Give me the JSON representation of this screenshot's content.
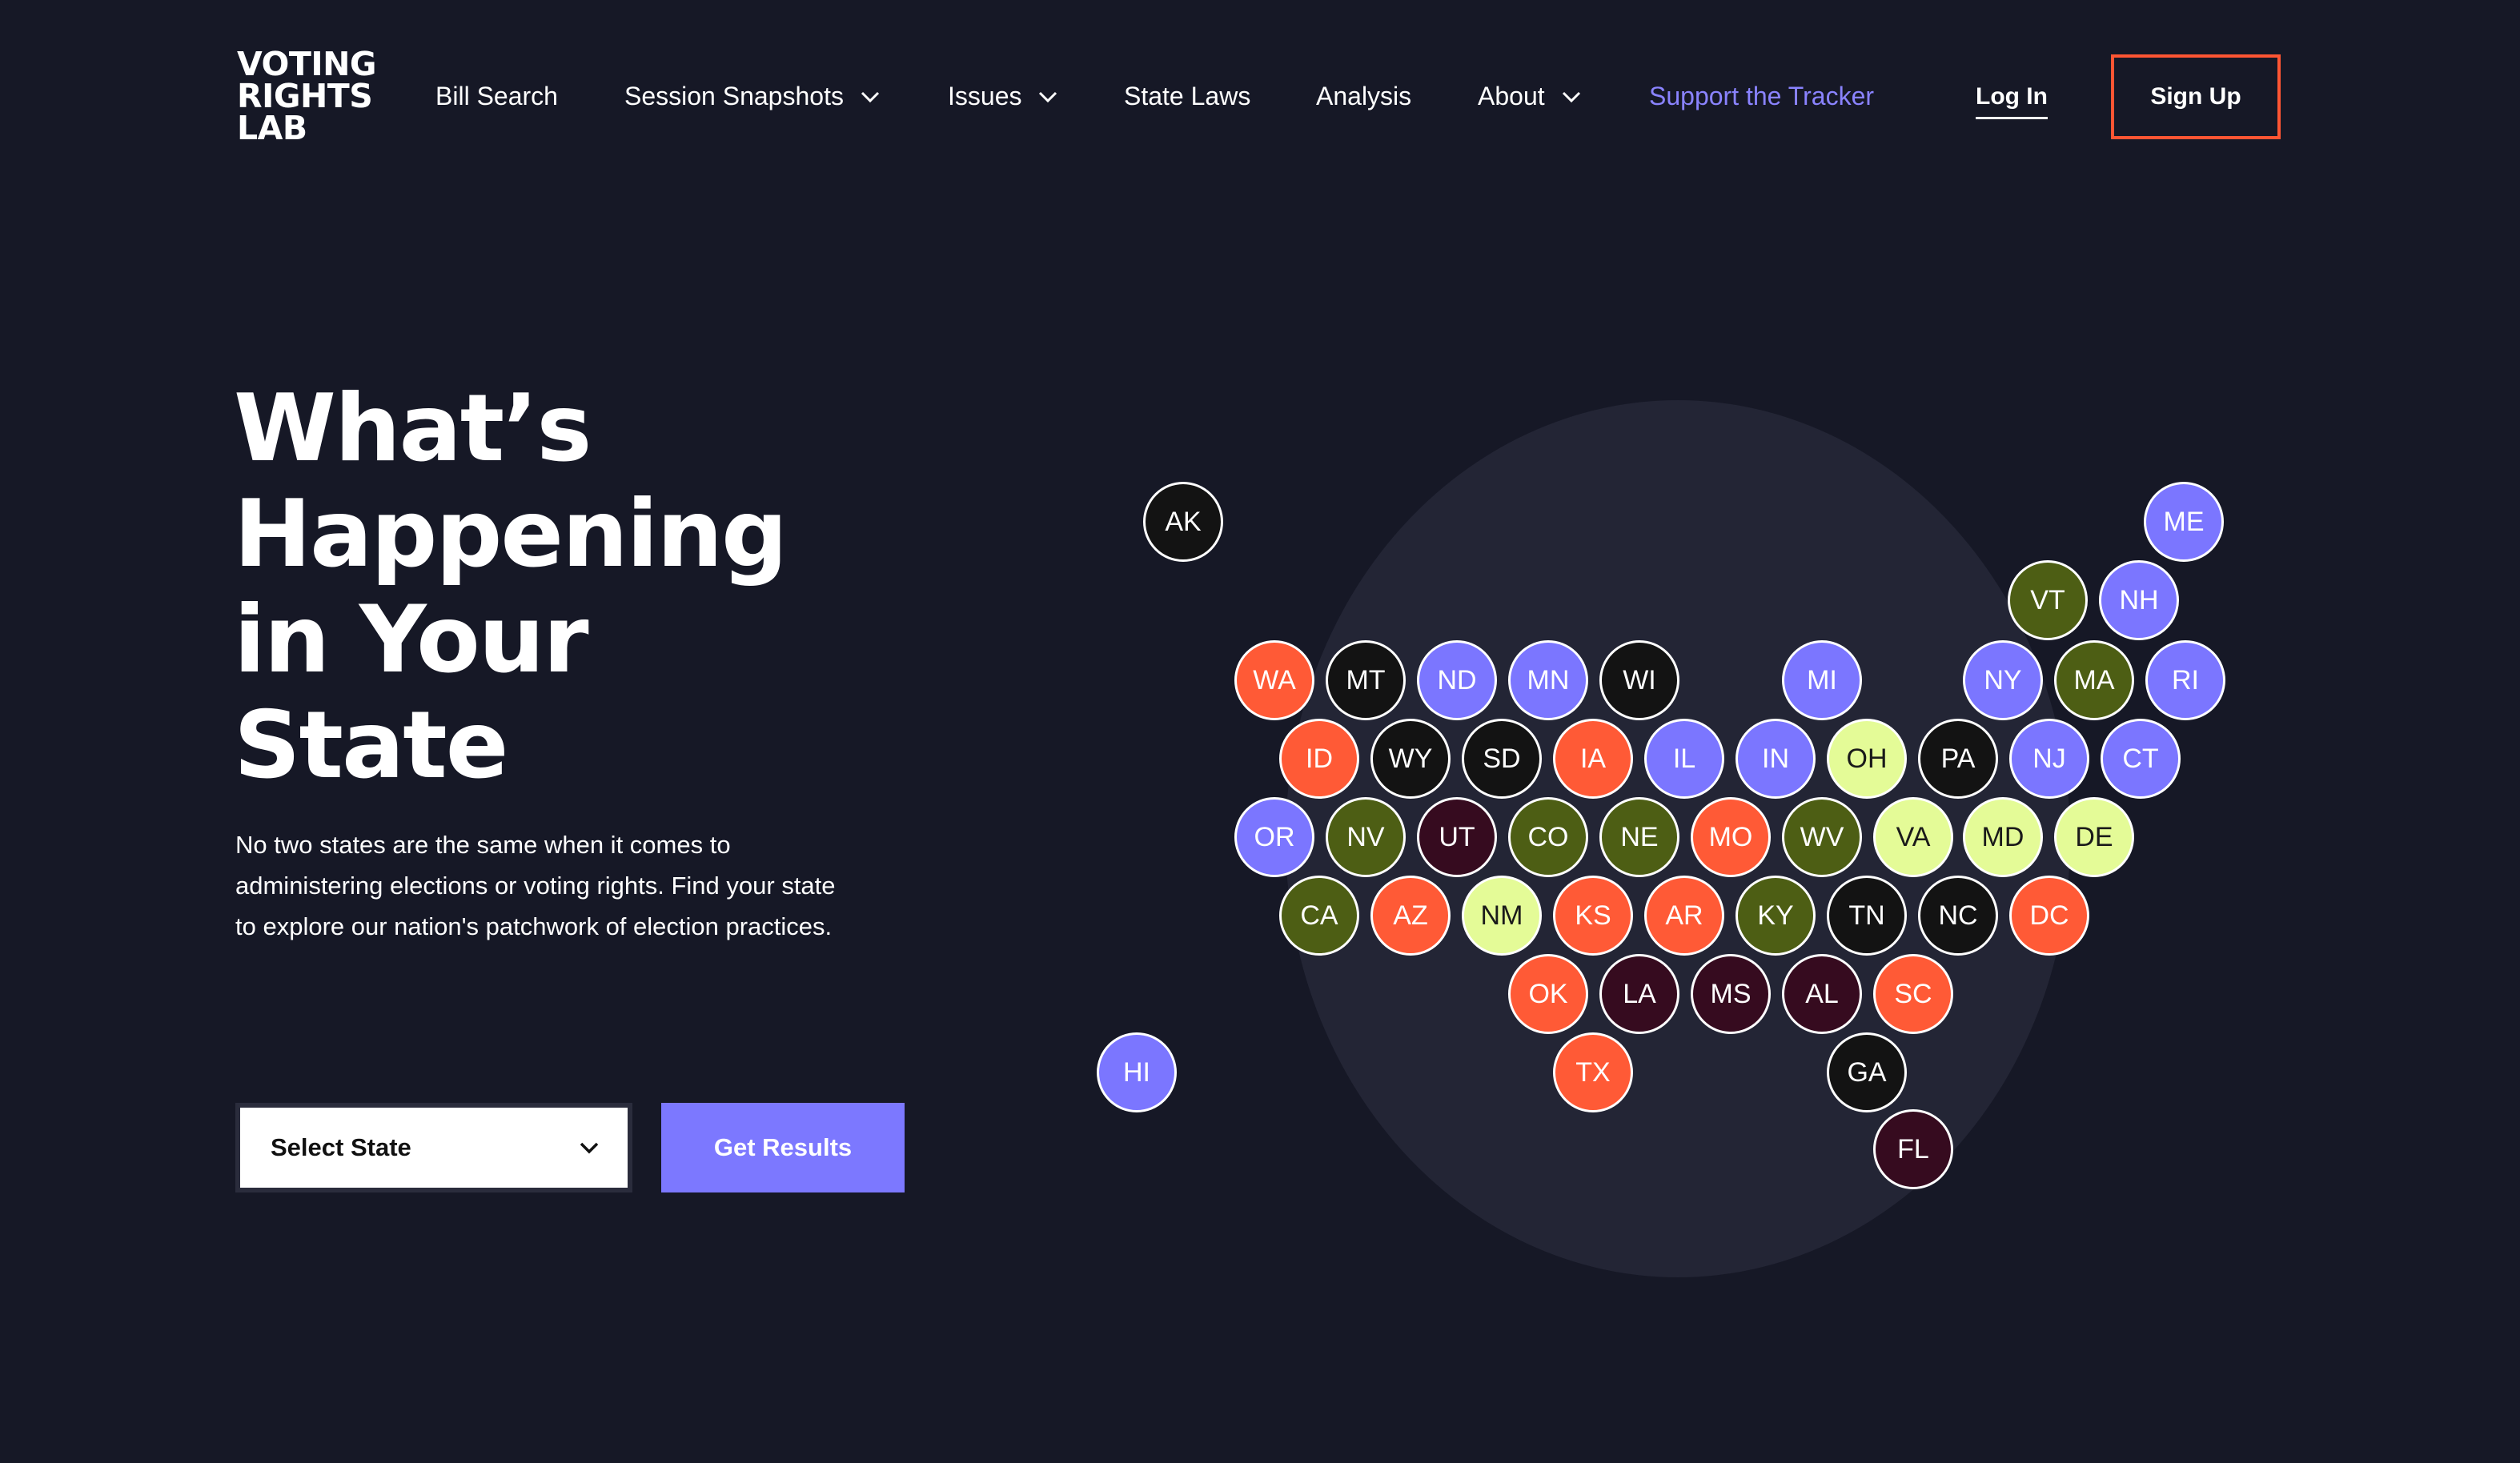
{
  "logo": {
    "lines": [
      "VOTING",
      "RIGHTS",
      "LAB"
    ]
  },
  "nav": {
    "bill_search": "Bill Search",
    "session_snapshots": "Session Snapshots",
    "issues": "Issues",
    "state_laws": "State Laws",
    "analysis": "Analysis",
    "about": "About",
    "support": "Support the Tracker",
    "log_in": "Log In",
    "sign_up": "Sign Up"
  },
  "hero": {
    "title_lines": [
      "What’s",
      "Happening",
      "in Your",
      "State"
    ],
    "description": "No two states are the same when it comes to administering elections or voting rights. Find your state to explore our nation's patchwork of election practices."
  },
  "controls": {
    "select_label": "Select State",
    "submit_label": "Get Results"
  },
  "colors": {
    "background": "#161826",
    "accent": "#7c78ff",
    "signup_border": "#ff5533",
    "black": "#131313",
    "purple": "#7b76ff",
    "orange": "#ff5a36",
    "olive": "#4d5e14",
    "lime": "#e4fb97",
    "maroon": "#360b1f"
  },
  "states": [
    {
      "abbr": "AK",
      "color": "black"
    },
    {
      "abbr": "ME",
      "color": "purple"
    },
    {
      "abbr": "VT",
      "color": "olive"
    },
    {
      "abbr": "NH",
      "color": "purple"
    },
    {
      "abbr": "WA",
      "color": "orange"
    },
    {
      "abbr": "MT",
      "color": "black"
    },
    {
      "abbr": "ND",
      "color": "purple"
    },
    {
      "abbr": "MN",
      "color": "purple"
    },
    {
      "abbr": "WI",
      "color": "black"
    },
    {
      "abbr": "MI",
      "color": "purple"
    },
    {
      "abbr": "NY",
      "color": "purple"
    },
    {
      "abbr": "MA",
      "color": "olive"
    },
    {
      "abbr": "RI",
      "color": "purple"
    },
    {
      "abbr": "ID",
      "color": "orange"
    },
    {
      "abbr": "WY",
      "color": "black"
    },
    {
      "abbr": "SD",
      "color": "black"
    },
    {
      "abbr": "IA",
      "color": "orange"
    },
    {
      "abbr": "IL",
      "color": "purple"
    },
    {
      "abbr": "IN",
      "color": "purple"
    },
    {
      "abbr": "OH",
      "color": "lime"
    },
    {
      "abbr": "PA",
      "color": "black"
    },
    {
      "abbr": "NJ",
      "color": "purple"
    },
    {
      "abbr": "CT",
      "color": "purple"
    },
    {
      "abbr": "OR",
      "color": "purple"
    },
    {
      "abbr": "NV",
      "color": "olive"
    },
    {
      "abbr": "UT",
      "color": "maroon"
    },
    {
      "abbr": "CO",
      "color": "olive"
    },
    {
      "abbr": "NE",
      "color": "olive"
    },
    {
      "abbr": "MO",
      "color": "orange"
    },
    {
      "abbr": "WV",
      "color": "olive"
    },
    {
      "abbr": "VA",
      "color": "lime"
    },
    {
      "abbr": "MD",
      "color": "lime"
    },
    {
      "abbr": "DE",
      "color": "lime"
    },
    {
      "abbr": "CA",
      "color": "olive"
    },
    {
      "abbr": "AZ",
      "color": "orange"
    },
    {
      "abbr": "NM",
      "color": "lime"
    },
    {
      "abbr": "KS",
      "color": "orange"
    },
    {
      "abbr": "AR",
      "color": "orange"
    },
    {
      "abbr": "KY",
      "color": "olive"
    },
    {
      "abbr": "TN",
      "color": "black"
    },
    {
      "abbr": "NC",
      "color": "black"
    },
    {
      "abbr": "DC",
      "color": "orange"
    },
    {
      "abbr": "OK",
      "color": "orange"
    },
    {
      "abbr": "LA",
      "color": "maroon"
    },
    {
      "abbr": "MS",
      "color": "maroon"
    },
    {
      "abbr": "AL",
      "color": "maroon"
    },
    {
      "abbr": "SC",
      "color": "orange"
    },
    {
      "abbr": "HI",
      "color": "purple"
    },
    {
      "abbr": "TX",
      "color": "orange"
    },
    {
      "abbr": "GA",
      "color": "black"
    },
    {
      "abbr": "FL",
      "color": "maroon"
    }
  ]
}
